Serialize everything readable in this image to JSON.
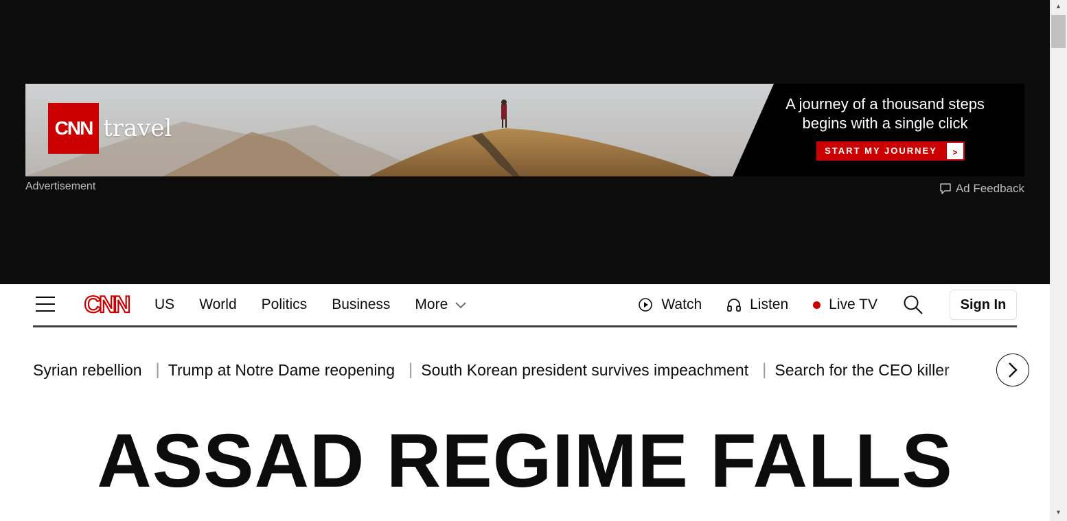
{
  "ad": {
    "brand": "CNN",
    "brand_suffix": "travel",
    "headline": "A journey of a thousand steps begins with a single click",
    "cta": "START MY JOURNEY",
    "cta_arrow": ">",
    "label": "Advertisement",
    "feedback": "Ad Feedback"
  },
  "header": {
    "logo_alt": "CNN",
    "nav": [
      "US",
      "World",
      "Politics",
      "Business",
      "More"
    ],
    "watch": "Watch",
    "listen": "Listen",
    "live_tv": "Live TV",
    "sign_in": "Sign In"
  },
  "trending": [
    "Syrian rebellion",
    "Trump at Notre Dame reopening",
    "South Korean president survives impeachment",
    "Search for the CEO killer"
  ],
  "headline": "ASSAD REGIME FALLS",
  "colors": {
    "brand_red": "#cc0000",
    "ad_background": "#0c0c0c",
    "text": "#0c0c0c"
  }
}
